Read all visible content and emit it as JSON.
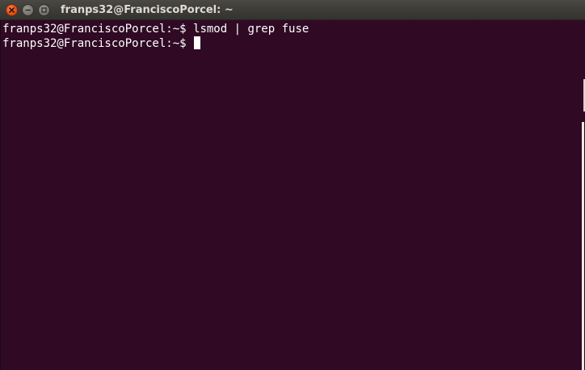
{
  "window": {
    "title": "franps32@FranciscoPorcel: ~",
    "buttons": {
      "close_icon": "close-icon",
      "minimize_icon": "minimize-icon",
      "maximize_icon": "maximize-icon"
    }
  },
  "terminal": {
    "lines": [
      {
        "prompt": "franps32@FranciscoPorcel:~$ ",
        "command": "lsmod | grep fuse"
      },
      {
        "prompt": "franps32@FranciscoPorcel:~$ ",
        "command": ""
      }
    ]
  },
  "colors": {
    "background": "#300a24",
    "text": "#ffffff",
    "titlebar": "#3c3b37",
    "close_button": "#e9591f"
  }
}
